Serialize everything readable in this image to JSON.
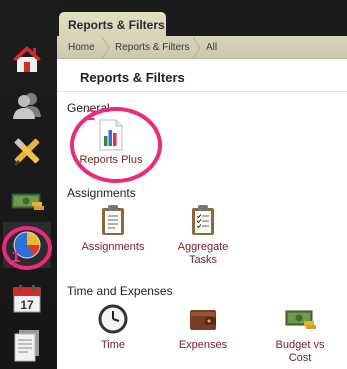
{
  "tab": {
    "label": "Reports & Filters"
  },
  "breadcrumb": [
    "Home",
    "Reports & Filters",
    "All"
  ],
  "page_title": "Reports & Filters",
  "sidebar": {
    "items": [
      {
        "icon": "home-icon"
      },
      {
        "icon": "user-icon"
      },
      {
        "icon": "tools-icon"
      },
      {
        "icon": "money-icon"
      },
      {
        "icon": "pie-chart-icon"
      },
      {
        "icon": "calendar-icon",
        "day": "17"
      },
      {
        "icon": "document-icon"
      }
    ]
  },
  "sections": {
    "general": {
      "title": "General",
      "items": [
        {
          "label": "Reports Plus",
          "icon": "reports-plus-icon"
        }
      ]
    },
    "assignments": {
      "title": "Assignments",
      "items": [
        {
          "label": "Assignments",
          "icon": "clipboard-icon"
        },
        {
          "label": "Aggregate Tasks",
          "icon": "checklist-icon"
        }
      ]
    },
    "time_expenses": {
      "title": "Time and Expenses",
      "items": [
        {
          "label": "Time",
          "icon": "clock-icon"
        },
        {
          "label": "Expenses",
          "icon": "wallet-icon"
        },
        {
          "label": "Budget vs Cost",
          "icon": "money-icon"
        }
      ]
    }
  },
  "annotations": {
    "first": "1",
    "second": "2",
    "color": "#ea2a7d"
  }
}
